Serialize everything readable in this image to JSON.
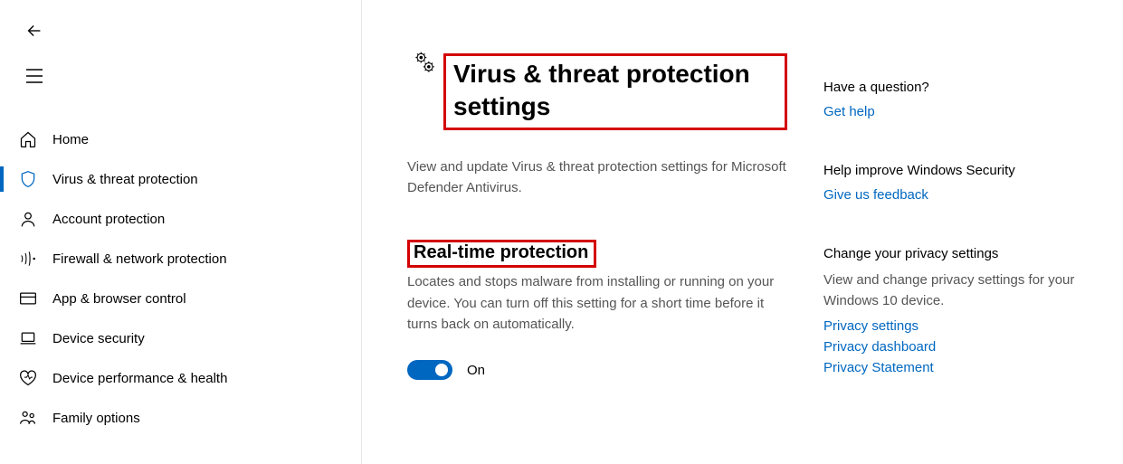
{
  "sidebar": {
    "items": [
      {
        "label": "Home"
      },
      {
        "label": "Virus & threat protection"
      },
      {
        "label": "Account protection"
      },
      {
        "label": "Firewall & network protection"
      },
      {
        "label": "App & browser control"
      },
      {
        "label": "Device security"
      },
      {
        "label": "Device performance & health"
      },
      {
        "label": "Family options"
      }
    ]
  },
  "page": {
    "title": "Virus & threat protection settings",
    "description": "View and update Virus & threat protection settings for Microsoft Defender Antivirus."
  },
  "realtime": {
    "title": "Real-time protection",
    "description": "Locates and stops malware from installing or running on your device. You can turn off this setting for a short time before it turns back on automatically.",
    "toggle_state": "On"
  },
  "aside": {
    "question": {
      "title": "Have a question?",
      "link": "Get help"
    },
    "improve": {
      "title": "Help improve Windows Security",
      "link": "Give us feedback"
    },
    "privacy": {
      "title": "Change your privacy settings",
      "description": "View and change privacy settings for your Windows 10 device.",
      "links": [
        "Privacy settings",
        "Privacy dashboard",
        "Privacy Statement"
      ]
    }
  }
}
